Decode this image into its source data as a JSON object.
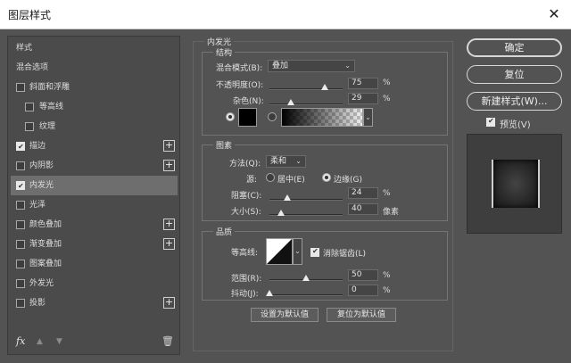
{
  "window": {
    "title": "图层样式",
    "close_glyph": "✕"
  },
  "styles_list": [
    {
      "label": "样式",
      "has_checkbox": false,
      "checked": false,
      "indent": false,
      "has_plus": false,
      "selected": false
    },
    {
      "label": "混合选项",
      "has_checkbox": false,
      "checked": false,
      "indent": false,
      "has_plus": false,
      "selected": false
    },
    {
      "label": "斜面和浮雕",
      "has_checkbox": true,
      "checked": false,
      "indent": false,
      "has_plus": false,
      "selected": false
    },
    {
      "label": "等高线",
      "has_checkbox": true,
      "checked": false,
      "indent": true,
      "has_plus": false,
      "selected": false
    },
    {
      "label": "纹理",
      "has_checkbox": true,
      "checked": false,
      "indent": true,
      "has_plus": false,
      "selected": false
    },
    {
      "label": "描边",
      "has_checkbox": true,
      "checked": true,
      "indent": false,
      "has_plus": true,
      "selected": false
    },
    {
      "label": "内阴影",
      "has_checkbox": true,
      "checked": false,
      "indent": false,
      "has_plus": true,
      "selected": false
    },
    {
      "label": "内发光",
      "has_checkbox": true,
      "checked": true,
      "indent": false,
      "has_plus": false,
      "selected": true
    },
    {
      "label": "光泽",
      "has_checkbox": true,
      "checked": false,
      "indent": false,
      "has_plus": false,
      "selected": false
    },
    {
      "label": "颜色叠加",
      "has_checkbox": true,
      "checked": false,
      "indent": false,
      "has_plus": true,
      "selected": false
    },
    {
      "label": "渐变叠加",
      "has_checkbox": true,
      "checked": false,
      "indent": false,
      "has_plus": true,
      "selected": false
    },
    {
      "label": "图案叠加",
      "has_checkbox": true,
      "checked": false,
      "indent": false,
      "has_plus": false,
      "selected": false
    },
    {
      "label": "外发光",
      "has_checkbox": true,
      "checked": false,
      "indent": false,
      "has_plus": false,
      "selected": false
    },
    {
      "label": "投影",
      "has_checkbox": true,
      "checked": false,
      "indent": false,
      "has_plus": true,
      "selected": false
    }
  ],
  "left_footer": {
    "fx_label": "fx",
    "move_up_icon": "arrow-up-icon",
    "move_down_icon": "arrow-down-icon",
    "delete_icon": "trash-icon"
  },
  "inner_glow": {
    "title": "内发光",
    "structure": {
      "title": "结构",
      "blend_mode_label": "混合模式(B):",
      "blend_mode_value": "叠加",
      "opacity_label": "不透明度(O):",
      "opacity_value": "75",
      "opacity_fraction": 0.75,
      "noise_label": "杂色(N):",
      "noise_value": "29",
      "noise_fraction": 0.29,
      "percent": "%",
      "color_swatch": "#000000"
    },
    "elements": {
      "title": "图素",
      "technique_label": "方法(Q):",
      "technique_value": "柔和",
      "source_label": "源:",
      "source_center": "居中(E)",
      "source_edge": "边缘(G)",
      "choke_label": "阻塞(C):",
      "choke_value": "24",
      "choke_fraction": 0.24,
      "size_label": "大小(S):",
      "size_value": "40",
      "size_fraction": 0.16,
      "percent": "%",
      "pixel_unit": "像素"
    },
    "quality": {
      "title": "品质",
      "contour_label": "等高线:",
      "anti_alias_label": "消除锯齿(L)",
      "range_label": "范围(R):",
      "range_value": "50",
      "range_fraction": 0.5,
      "jitter_label": "抖动(J):",
      "jitter_value": "0",
      "jitter_fraction": 0.0,
      "percent": "%"
    },
    "make_default": "设置为默认值",
    "reset_default": "复位为默认值"
  },
  "right_panel": {
    "ok": "确定",
    "reset": "复位",
    "new_style": "新建样式(W)...",
    "preview_label": "预览(V)"
  }
}
